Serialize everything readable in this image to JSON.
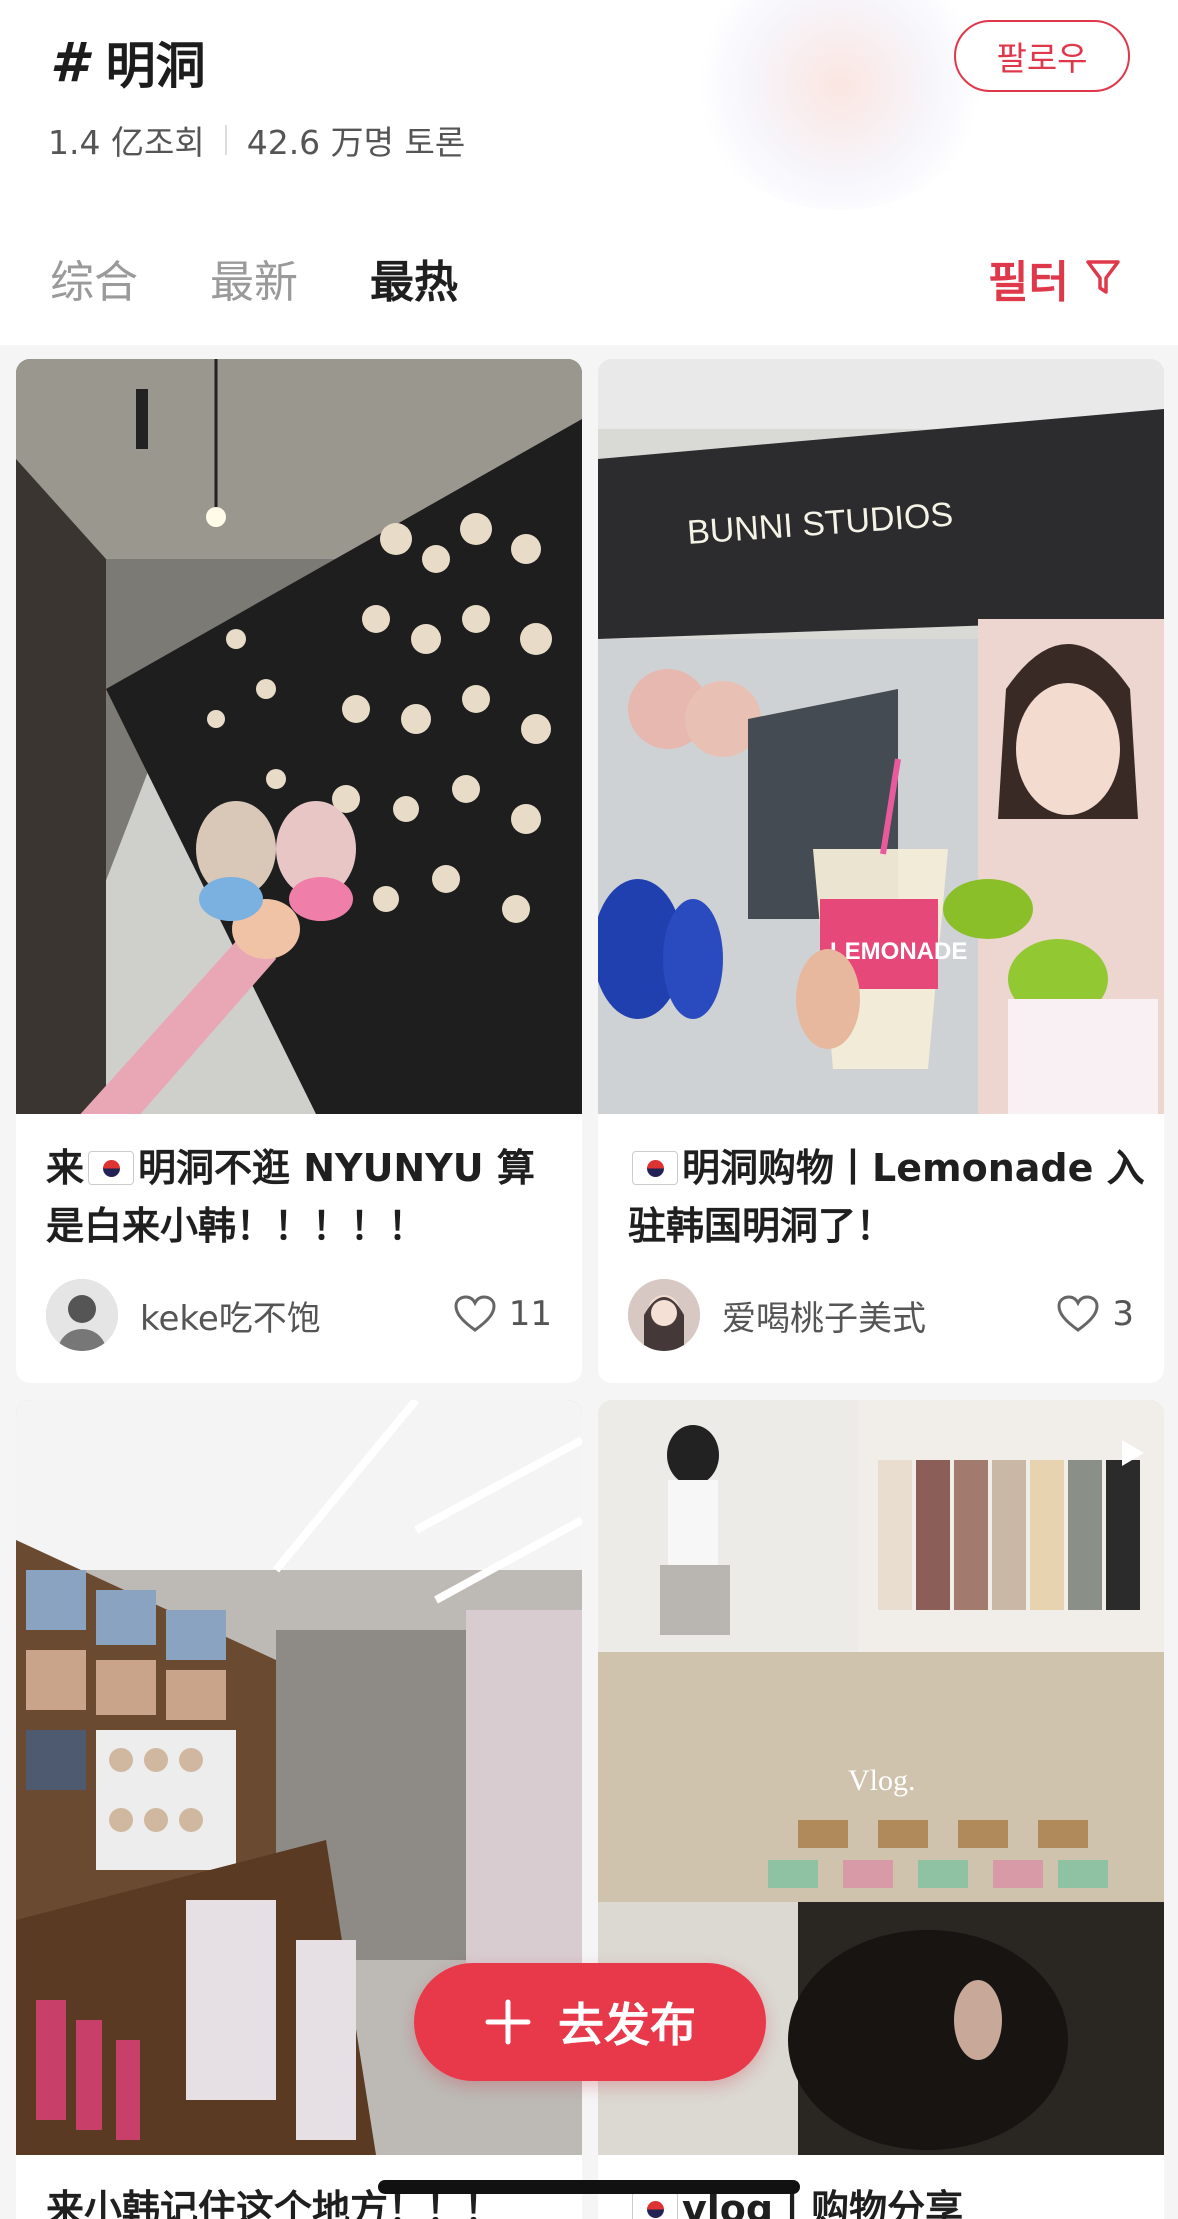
{
  "header": {
    "hash_symbol": "#",
    "topic": "明洞",
    "views": "1.4 亿조회",
    "discussions": "42.6 万명 토론",
    "follow_label": "팔로우"
  },
  "tabs": [
    {
      "label": "综合"
    },
    {
      "label": "最新"
    },
    {
      "label": "最热"
    }
  ],
  "active_tab": "最热",
  "filter_label": "필터",
  "cards": [
    {
      "caption_pre": "来",
      "caption_post": "明洞不逛 NYUNYU 算是白来小韩！！！！！",
      "author": "keke吃不饱",
      "likes": "11",
      "photo_icon": "keychain-shop-photo"
    },
    {
      "caption_pre": "",
      "caption_post": "明洞购物丨Lemonade 入驻韩国明洞了！",
      "author": "爱喝桃子美式",
      "likes": "3",
      "photo_icon": "lemonade-store-photo",
      "photo_text": "BUNNI STUDIOS",
      "cup_text": "LEMONADE"
    },
    {
      "caption_post": "来小韩记住这个地方！！！",
      "photo_icon": "music-store-photo"
    },
    {
      "caption_pre": "",
      "caption_post": "vlog丨购物分享",
      "photo_icon": "vlog-collage-photo",
      "photo_text": "Vlog."
    }
  ],
  "publish_label": "去发布",
  "colors": {
    "accent": "#e0384b",
    "active_tab": "#1f1f1f",
    "inactive_tab": "#9a9a9a"
  }
}
